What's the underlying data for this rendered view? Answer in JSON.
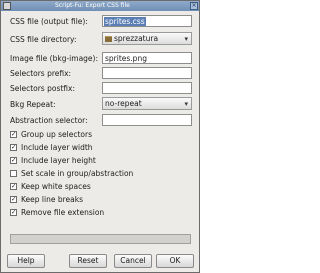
{
  "window": {
    "title": "Script-Fu: Export CSS file"
  },
  "form": {
    "css_file": {
      "label": "CSS file (output file):",
      "value": "sprites.css"
    },
    "css_dir": {
      "label": "CSS file directory:",
      "value": "sprezzatura"
    },
    "image_file": {
      "label": "Image file (bkg-image):",
      "value": "sprites.png"
    },
    "selectors_prefix": {
      "label": "Selectors prefix:",
      "value": ""
    },
    "selectors_postfix": {
      "label": "Selectors postfix:",
      "value": ""
    },
    "bkg_repeat": {
      "label": "Bkg Repeat:",
      "value": "no-repeat"
    },
    "abstraction_selector": {
      "label": "Abstraction selector:",
      "value": ""
    }
  },
  "checkboxes": [
    {
      "label": "Group up selectors",
      "checked": true
    },
    {
      "label": "Include layer width",
      "checked": true
    },
    {
      "label": "Include layer height",
      "checked": true
    },
    {
      "label": "Set scale in group/abstraction",
      "checked": false
    },
    {
      "label": "Keep white spaces",
      "checked": true
    },
    {
      "label": "Keep line breaks",
      "checked": true
    },
    {
      "label": "Remove file extension",
      "checked": true
    }
  ],
  "buttons": {
    "help": "Help",
    "reset": "Reset",
    "cancel": "Cancel",
    "ok": "OK"
  }
}
